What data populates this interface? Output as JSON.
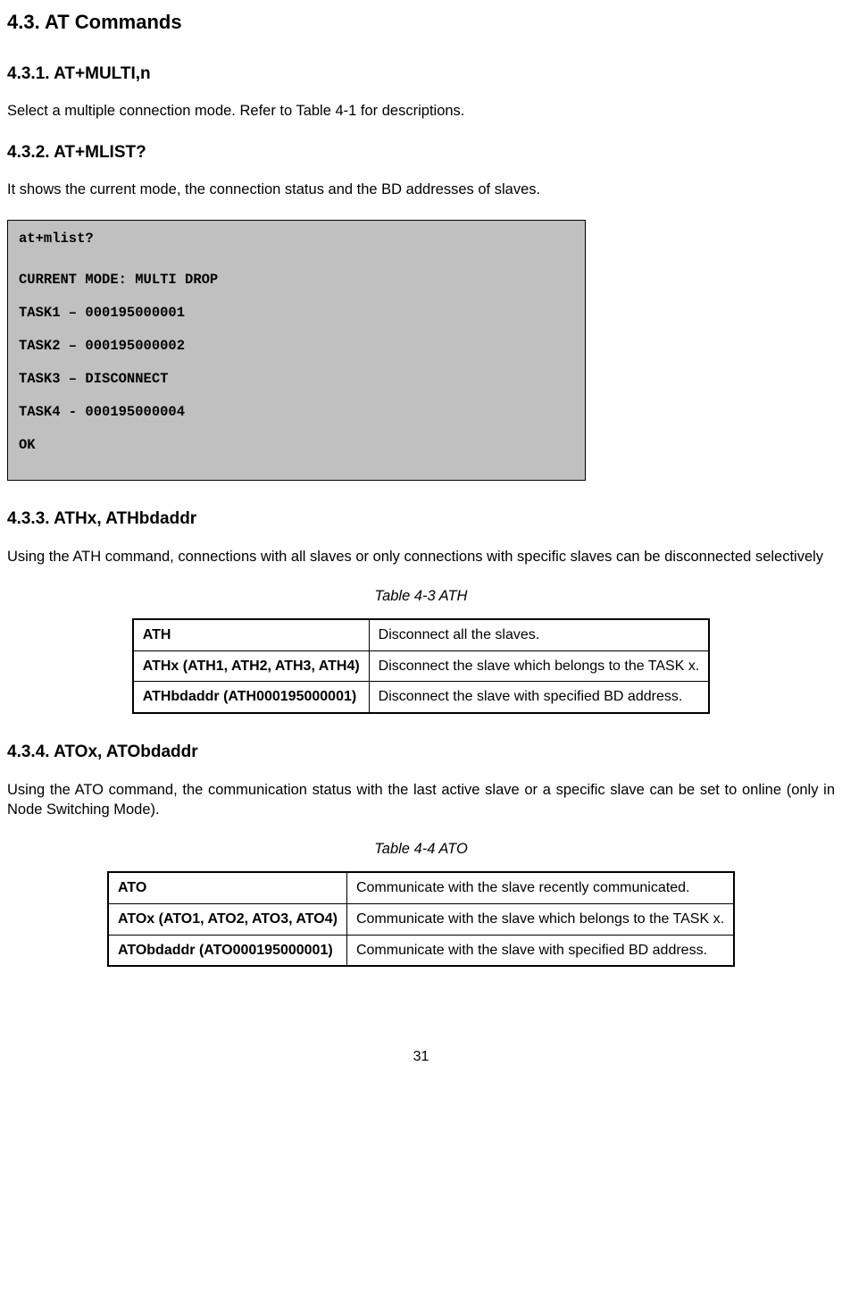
{
  "h2": "4.3. AT Commands",
  "s1": {
    "heading": "4.3.1. AT+MULTI,n",
    "para": "Select a multiple connection mode. Refer to Table 4-1 for descriptions."
  },
  "s2": {
    "heading": "4.3.2. AT+MLIST?",
    "para": "It shows the current mode, the connection status and the BD addresses of slaves.",
    "code": {
      "l0": "at+mlist?",
      "l1": "CURRENT MODE: MULTI DROP",
      "l2": "TASK1 – 000195000001",
      "l3": "TASK2 – 000195000002",
      "l4": "TASK3 – DISCONNECT",
      "l5": "TASK4 - 000195000004",
      "l6": "OK"
    }
  },
  "s3": {
    "heading": "4.3.3. ATHx, ATHbdaddr",
    "para": "Using the ATH command, connections with all slaves or only connections with specific slaves can be disconnected selectively",
    "caption": "Table 4-3 ATH",
    "rows": [
      {
        "cmd": "ATH",
        "desc": "Disconnect all the slaves."
      },
      {
        "cmd": "ATHx (ATH1, ATH2, ATH3, ATH4)",
        "desc": "Disconnect the slave which belongs to the TASK x."
      },
      {
        "cmd": "ATHbdaddr (ATH000195000001)",
        "desc": "Disconnect the slave with specified BD address."
      }
    ]
  },
  "s4": {
    "heading": "4.3.4. ATOx, ATObdaddr",
    "para": "Using the ATO command, the communication status with the last active slave or a specific slave can be set to online (only in Node Switching Mode).",
    "caption": "Table 4-4 ATO",
    "rows": [
      {
        "cmd": "ATO",
        "desc": "Communicate with the slave recently communicated."
      },
      {
        "cmd": "ATOx (ATO1, ATO2, ATO3, ATO4)",
        "desc": "Communicate with the slave which belongs to the TASK x."
      },
      {
        "cmd": "ATObdaddr (ATO000195000001)",
        "desc": "Communicate with the slave with specified BD address."
      }
    ]
  },
  "page": "31"
}
